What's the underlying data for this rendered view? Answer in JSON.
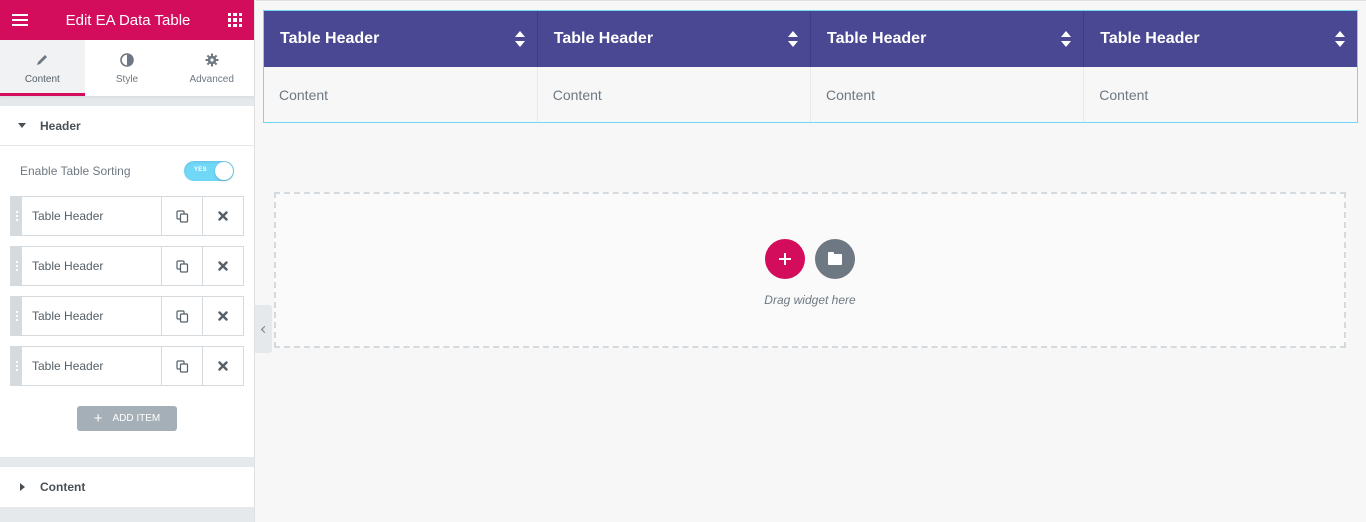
{
  "editor": {
    "title": "Edit EA Data Table",
    "tabs": [
      {
        "label": "Content",
        "icon": "pencil-icon",
        "active": true
      },
      {
        "label": "Style",
        "icon": "contrast-icon",
        "active": false
      },
      {
        "label": "Advanced",
        "icon": "gear-icon",
        "active": false
      }
    ],
    "header_section": {
      "title": "Header",
      "sorting_label": "Enable Table Sorting",
      "sorting_toggle": "YES",
      "items": [
        {
          "label": "Table Header"
        },
        {
          "label": "Table Header"
        },
        {
          "label": "Table Header"
        },
        {
          "label": "Table Header"
        }
      ],
      "add_item_label": "ADD ITEM"
    },
    "content_section": {
      "title": "Content"
    }
  },
  "table": {
    "headers": [
      "Table Header",
      "Table Header",
      "Table Header",
      "Table Header"
    ],
    "rows": [
      [
        "Content",
        "Content",
        "Content",
        "Content"
      ]
    ]
  },
  "drop_zone": {
    "text": "Drag widget here"
  },
  "colors": {
    "brand": "#d30c5c",
    "table_header_bg": "#4a4893",
    "toggle_on": "#71d7f7"
  }
}
